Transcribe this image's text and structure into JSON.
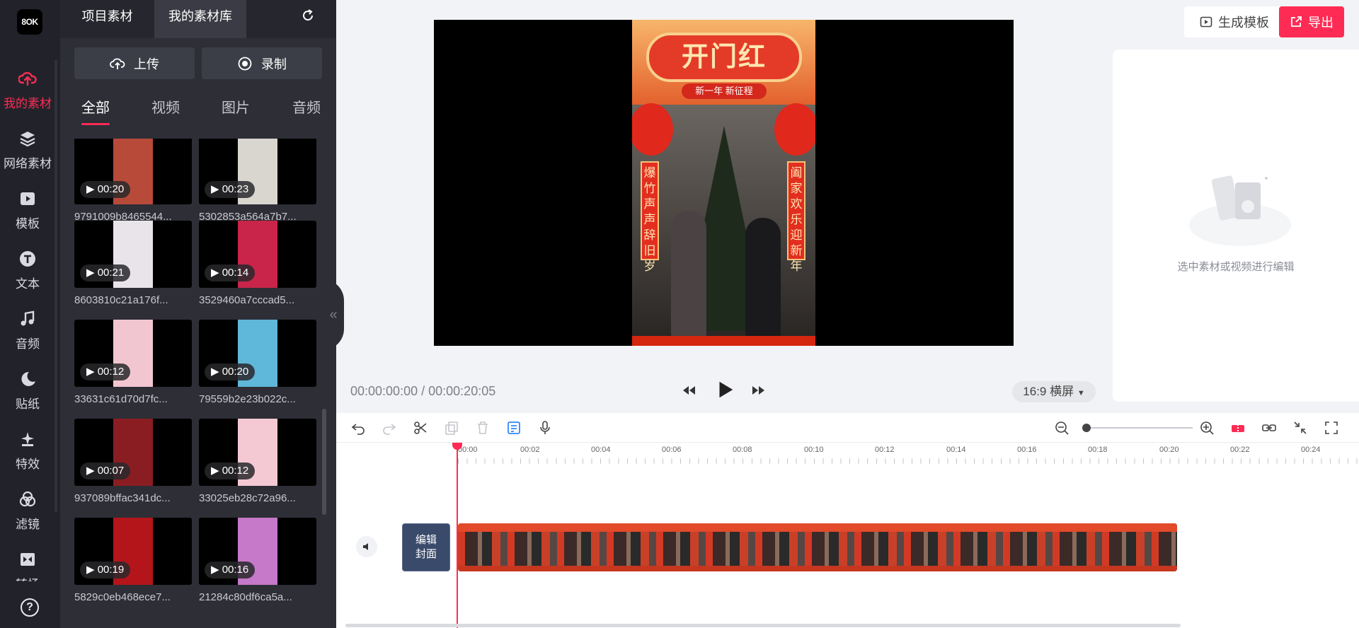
{
  "app": {
    "logo_text": "8OK"
  },
  "rail": {
    "items": [
      {
        "label": "我的素材",
        "icon": "upload-cloud-icon",
        "active": true
      },
      {
        "label": "网络素材",
        "icon": "layers-icon"
      },
      {
        "label": "模板",
        "icon": "play-box-icon"
      },
      {
        "label": "文本",
        "icon": "text-t-icon"
      },
      {
        "label": "音频",
        "icon": "music-note-icon"
      },
      {
        "label": "贴纸",
        "icon": "moon-icon"
      },
      {
        "label": "特效",
        "icon": "sparkle-icon"
      },
      {
        "label": "滤镜",
        "icon": "filter-circles-icon"
      },
      {
        "label": "转场",
        "icon": "transition-icon"
      }
    ],
    "help_label": "?"
  },
  "panel": {
    "tabs": [
      "项目素材",
      "我的素材库"
    ],
    "active_tab": "我的素材库",
    "upload_label": "上传",
    "record_label": "录制",
    "filters": [
      "全部",
      "视频",
      "图片",
      "音频"
    ],
    "active_filter": "全部",
    "assets": [
      {
        "duration": "00:20",
        "name": "9791009b8465544...",
        "color": "#b84a3a"
      },
      {
        "duration": "00:23",
        "name": "5302853a564a7b7...",
        "color": "#d9d6cf"
      },
      {
        "duration": "00:21",
        "name": "8603810c21a176f...",
        "color": "#e8e4ea"
      },
      {
        "duration": "00:14",
        "name": "3529460a7cccad5...",
        "color": "#c9244a"
      },
      {
        "duration": "00:12",
        "name": "33631c61d70d7fc...",
        "color": "#f2c6d0"
      },
      {
        "duration": "00:20",
        "name": "79559b2e23b022c...",
        "color": "#5fb7d9"
      },
      {
        "duration": "00:07",
        "name": "937089bffac341dc...",
        "color": "#8a1d22"
      },
      {
        "duration": "00:12",
        "name": "33025eb28c72a96...",
        "color": "#f5c9d4"
      },
      {
        "duration": "00:19",
        "name": "5829c0eb468ece7...",
        "color": "#b3151a"
      },
      {
        "duration": "00:16",
        "name": "21284c80df6ca5a...",
        "color": "#c678c9"
      }
    ]
  },
  "preview": {
    "video_title": "开门红",
    "video_subtitle": "新一年 新征程",
    "left_couplet": "爆竹声声辞旧岁",
    "right_couplet": "阖家欢乐迎新年",
    "current_time": "00:00:00:00",
    "separator": "/",
    "total_time": "00:00:20:05",
    "ratio_label": "16:9 横屏"
  },
  "header": {
    "generate_template_label": "生成模板",
    "export_label": "导出"
  },
  "properties": {
    "empty_text": "选中素材或视频进行编辑"
  },
  "timeline": {
    "ticks": [
      "00:00",
      "00:02",
      "00:04",
      "00:06",
      "00:08",
      "00:10",
      "00:12",
      "00:14",
      "00:16",
      "00:18",
      "00:20",
      "00:22",
      "00:24"
    ],
    "cover_label_1": "编辑",
    "cover_label_2": "封面"
  },
  "colors": {
    "accent": "#fe2c55",
    "rail_bg": "#22232a",
    "panel_bg": "#2d2e36"
  }
}
